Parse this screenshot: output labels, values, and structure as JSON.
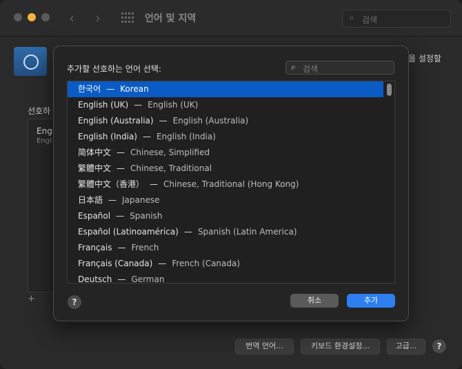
{
  "titlebar": {
    "title": "언어 및 지역",
    "search_placeholder": "검색",
    "back_icon": "chevron-left-icon",
    "forward_icon": "chevron-right-icon",
    "grid_icon": "grid-icon"
  },
  "background": {
    "right_text": "을 설정할",
    "section_label": "선호하",
    "list_item_primary": "Eng",
    "list_item_secondary": "Engl",
    "plus": "+",
    "buttons": {
      "translate": "번역 언어...",
      "keyboard": "키보드 환경설정...",
      "advanced": "고급..."
    }
  },
  "modal": {
    "title": "추가할 선호하는 언어 선택:",
    "search_placeholder": "검색",
    "items": [
      {
        "native": "한국어",
        "english": "Korean",
        "selected": true
      },
      {
        "native": "English (UK)",
        "english": "English (UK)"
      },
      {
        "native": "English (Australia)",
        "english": "English (Australia)"
      },
      {
        "native": "English (India)",
        "english": "English (India)"
      },
      {
        "native": "简体中文",
        "english": "Chinese, Simplified"
      },
      {
        "native": "繁體中文",
        "english": "Chinese, Traditional"
      },
      {
        "native": "繁體中文（香港）",
        "english": "Chinese, Traditional (Hong Kong)"
      },
      {
        "native": "日本語",
        "english": "Japanese"
      },
      {
        "native": "Español",
        "english": "Spanish"
      },
      {
        "native": "Español (Latinoamérica)",
        "english": "Spanish (Latin America)"
      },
      {
        "native": "Français",
        "english": "French"
      },
      {
        "native": "Français (Canada)",
        "english": "French (Canada)"
      },
      {
        "native": "Deutsch",
        "english": "German"
      }
    ],
    "separator": "—",
    "help": "?",
    "cancel_label": "취소",
    "add_label": "추가"
  },
  "colors": {
    "accent": "#2d7ff0",
    "selection": "#0a5bc4"
  }
}
